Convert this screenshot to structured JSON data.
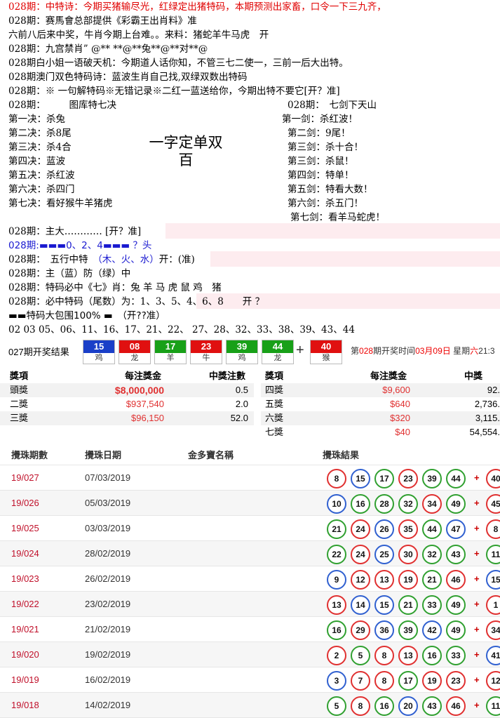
{
  "lines": [
    {
      "text": "028期：中特诗：今期买猪输尽光，红绿定出猪特码，本期预测出家畜，口令一下三九齐，",
      "red": true
    },
    {
      "text": "028期：赛馬會总部提供《彩霸王出肖料》准"
    },
    {
      "text": "六前八后来中奖，牛肖今期上台难。。来料：猪蛇羊牛马虎　开"
    },
    {
      "text": "028期：九宫禁肖” @** **@**兔**@**对**@"
    },
    {
      "text": "028期白小姐一语破天机：今期道人话你知，不管三七二使一，三前一后大出特。"
    },
    {
      "text": "028期澳门双色特码诗：蓝波生肖自己找,双绿双数出特码"
    },
    {
      "text": "028期：※ 一句解特码※无错记录※二红一蓝送给你，今期出特不要它[开？准]"
    }
  ],
  "left_col": {
    "header": "028期：　　　图库特七决",
    "items": [
      "第一决：杀兔",
      "第二决：杀8尾",
      "第三决：杀4合",
      "第四决：蓝波",
      "第五决：杀红波",
      "第六决：杀四门",
      "第七决：看好猴牛羊猪虎"
    ]
  },
  "right_col": {
    "header": "028期：　七剑下天山",
    "items": [
      "第一剑：杀红波！",
      "第二剑：9尾！",
      "第三剑：杀十合！",
      "第三剑：杀鼠！",
      "第四剑：特单！",
      "第五剑：特看大数！",
      "第六剑：杀五门！",
      "第七剑：看羊马蛇虎！"
    ]
  },
  "big_text": {
    "line1": "一字定单双",
    "line2": "百"
  },
  "lines2": [
    {
      "text": "028期：主大………… [开？准]"
    },
    {
      "text": "028期:▬▬▬0、2、4▬▬▬ ？头",
      "blue": true
    },
    {
      "text": "028期：　五行中特　（木、火、水）开：(准)",
      "blue_part": "（木、火、水）"
    },
    {
      "text": "028期：主（蓝）防（绿）中"
    },
    {
      "text": "028期：特码必中《七》肖：兔 羊 马 虎 鼠 鸡　猪"
    },
    {
      "text": "028期：必中特码（尾数）为：1、3、5、4、6、8　　开 ？"
    },
    {
      "text": "▬▬特码大包围100% ▬　（开??准）"
    },
    {
      "text": "02 03 05、06、11、16、17、21、22、 27、28、32、33、38、39、43、44"
    }
  ],
  "draw": {
    "label": "027期开奖结果",
    "balls": [
      {
        "n": "15",
        "z": "鸡",
        "c": "blue"
      },
      {
        "n": "08",
        "z": "龙",
        "c": "red"
      },
      {
        "n": "17",
        "z": "羊",
        "c": "green"
      },
      {
        "n": "23",
        "z": "牛",
        "c": "red"
      },
      {
        "n": "39",
        "z": "鸡",
        "c": "green"
      },
      {
        "n": "44",
        "z": "龙",
        "c": "green"
      },
      {
        "n": "40",
        "z": "猴",
        "c": "red"
      }
    ],
    "plus": "+",
    "next_prefix": "第",
    "next_period": "028",
    "next_mid": "期开奖时间",
    "next_date": "03月09日",
    "next_week": "星期",
    "next_weekday": "六",
    "next_time": "21:3"
  },
  "prize_left": {
    "headers": [
      "獎項",
      "每注獎金",
      "中獎注數"
    ],
    "rows": [
      [
        "頭獎",
        "$8,000,000",
        "0.5"
      ],
      [
        "二獎",
        "$937,540",
        "2.0"
      ],
      [
        "三獎",
        "$96,150",
        "52.0"
      ]
    ]
  },
  "prize_right": {
    "headers": [
      "獎項",
      "每注獎金",
      "中獎"
    ],
    "rows": [
      [
        "四獎",
        "$9,600",
        "92."
      ],
      [
        "五獎",
        "$640",
        "2,736."
      ],
      [
        "六獎",
        "$320",
        "3,115."
      ],
      [
        "七獎",
        "$40",
        "54,554."
      ]
    ]
  },
  "history": {
    "headers": [
      "攪珠期數",
      "攪珠日期",
      "金多寶名稱",
      "攪珠結果"
    ],
    "rows": [
      {
        "per": "19/027",
        "date": "07/03/2019",
        "balls": [
          "8",
          "15",
          "17",
          "23",
          "39",
          "44"
        ],
        "sp": "40",
        "cols": [
          "r",
          "bl",
          "g",
          "r",
          "g",
          "g"
        ],
        "spc": "r"
      },
      {
        "per": "19/026",
        "date": "05/03/2019",
        "balls": [
          "10",
          "16",
          "28",
          "32",
          "34",
          "49"
        ],
        "sp": "45",
        "cols": [
          "bl",
          "g",
          "g",
          "g",
          "r",
          "g"
        ],
        "spc": "r"
      },
      {
        "per": "19/025",
        "date": "03/03/2019",
        "balls": [
          "21",
          "24",
          "26",
          "35",
          "44",
          "47"
        ],
        "sp": "8",
        "cols": [
          "g",
          "r",
          "bl",
          "r",
          "g",
          "bl"
        ],
        "spc": "r"
      },
      {
        "per": "19/024",
        "date": "28/02/2019",
        "balls": [
          "22",
          "24",
          "25",
          "30",
          "32",
          "43"
        ],
        "sp": "11",
        "cols": [
          "g",
          "r",
          "bl",
          "r",
          "g",
          "g"
        ],
        "spc": "g"
      },
      {
        "per": "19/023",
        "date": "26/02/2019",
        "balls": [
          "9",
          "12",
          "13",
          "19",
          "21",
          "46"
        ],
        "sp": "15",
        "cols": [
          "bl",
          "r",
          "r",
          "r",
          "g",
          "r"
        ],
        "spc": "bl"
      },
      {
        "per": "19/022",
        "date": "23/02/2019",
        "balls": [
          "13",
          "14",
          "15",
          "21",
          "33",
          "49"
        ],
        "sp": "1",
        "cols": [
          "r",
          "bl",
          "bl",
          "g",
          "g",
          "g"
        ],
        "spc": "r"
      },
      {
        "per": "19/021",
        "date": "21/02/2019",
        "balls": [
          "16",
          "29",
          "36",
          "39",
          "42",
          "49"
        ],
        "sp": "34",
        "cols": [
          "g",
          "r",
          "bl",
          "g",
          "bl",
          "g"
        ],
        "spc": "r"
      },
      {
        "per": "19/020",
        "date": "19/02/2019",
        "balls": [
          "2",
          "5",
          "8",
          "13",
          "16",
          "33"
        ],
        "sp": "41",
        "cols": [
          "r",
          "g",
          "r",
          "r",
          "g",
          "g"
        ],
        "spc": "bl"
      },
      {
        "per": "19/019",
        "date": "16/02/2019",
        "balls": [
          "3",
          "7",
          "8",
          "17",
          "19",
          "23"
        ],
        "sp": "12",
        "cols": [
          "bl",
          "r",
          "r",
          "g",
          "r",
          "r"
        ],
        "spc": "r"
      },
      {
        "per": "19/018",
        "date": "14/02/2019",
        "balls": [
          "5",
          "8",
          "16",
          "20",
          "43",
          "46"
        ],
        "sp": "11",
        "cols": [
          "g",
          "r",
          "g",
          "bl",
          "g",
          "r"
        ],
        "spc": "g"
      }
    ]
  }
}
